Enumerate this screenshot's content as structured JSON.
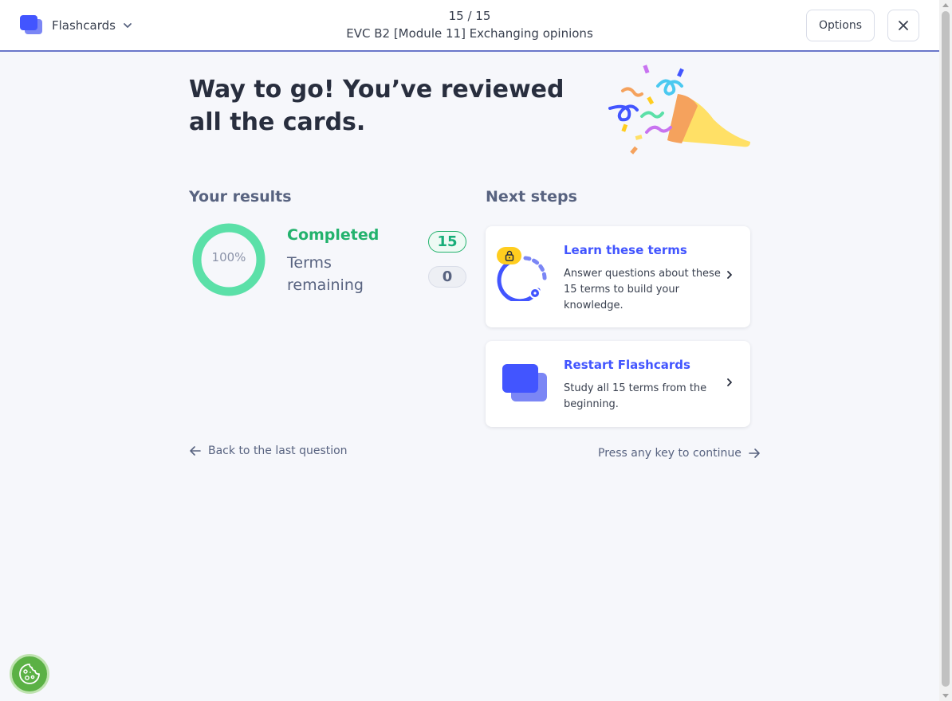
{
  "header": {
    "mode_label": "Flashcards",
    "progress": "15 / 15",
    "set_title": "EVC B2 [Module 11] Exchanging opinions",
    "options_label": "Options"
  },
  "main": {
    "headline": "Way to go! You’ve reviewed all the cards."
  },
  "results": {
    "title": "Your results",
    "percent_label": "100%",
    "percent_value": 1.0,
    "completed_label": "Completed",
    "completed_count": "15",
    "remaining_label": "Terms remaining",
    "remaining_count": "0"
  },
  "next_steps": {
    "title": "Next steps",
    "learn": {
      "title": "Learn these terms",
      "description": "Answer questions about these 15 terms to build your knowledge."
    },
    "restart": {
      "title": "Restart Flashcards",
      "description": "Study all 15 terms from the beginning."
    }
  },
  "footer": {
    "back_label": "Back to the last question",
    "continue_label": "Press any key to continue"
  },
  "colors": {
    "accent": "#4255ff",
    "success": "#23b26d",
    "ring": "#5be0a8",
    "lock": "#ffcd1f",
    "cookie": "#5bb145"
  },
  "icons": [
    "flashcards-icon",
    "chevron-down-icon",
    "close-icon",
    "confetti-popper-icon",
    "lock-icon",
    "learn-mode-icon",
    "chevron-right-icon",
    "arrow-left-icon",
    "arrow-right-icon",
    "cookie-icon"
  ]
}
